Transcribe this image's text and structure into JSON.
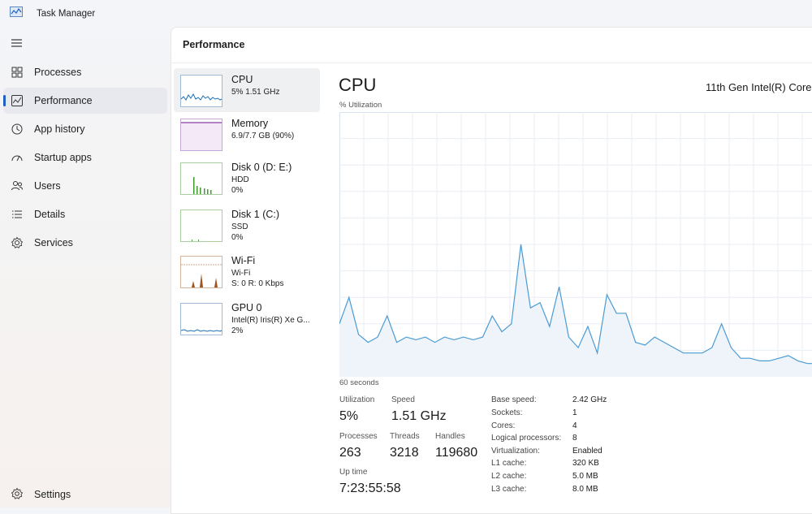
{
  "window": {
    "title": "Task Manager"
  },
  "nav": {
    "items": [
      {
        "label": "Processes",
        "icon": "processes-icon"
      },
      {
        "label": "Performance",
        "icon": "performance-icon",
        "selected": true
      },
      {
        "label": "App history",
        "icon": "app-history-icon"
      },
      {
        "label": "Startup apps",
        "icon": "startup-apps-icon"
      },
      {
        "label": "Users",
        "icon": "users-icon"
      },
      {
        "label": "Details",
        "icon": "details-icon"
      },
      {
        "label": "Services",
        "icon": "services-icon"
      }
    ],
    "settings_label": "Settings"
  },
  "main": {
    "header": "Performance"
  },
  "devices": [
    {
      "name": "CPU",
      "line1": "5%  1.51 GHz",
      "line2": "",
      "color": "#1b6fb8",
      "selected": true
    },
    {
      "name": "Memory",
      "line1": "6.9/7.7 GB (90%)",
      "line2": "",
      "color": "#8b3fa8"
    },
    {
      "name": "Disk 0 (D: E:)",
      "line1": "HDD",
      "line2": "0%",
      "color": "#3f9b2e"
    },
    {
      "name": "Disk 1 (C:)",
      "line1": "SSD",
      "line2": "0%",
      "color": "#3f9b2e"
    },
    {
      "name": "Wi-Fi",
      "line1": "Wi-Fi",
      "line2": "S: 0 R: 0 Kbps",
      "color": "#a0521d"
    },
    {
      "name": "GPU 0",
      "line1": "Intel(R) Iris(R) Xe G...",
      "line2": "2%",
      "color": "#1b6fb8"
    }
  ],
  "detail": {
    "title": "CPU",
    "model": "11th Gen Intel(R) Core",
    "util_label": "% Utilization",
    "time_label": "60 seconds",
    "stats": {
      "utilization_label": "Utilization",
      "utilization": "5%",
      "speed_label": "Speed",
      "speed": "1.51 GHz",
      "processes_label": "Processes",
      "processes": "263",
      "threads_label": "Threads",
      "threads": "3218",
      "handles_label": "Handles",
      "handles": "119680",
      "uptime_label": "Up time",
      "uptime": "7:23:55:58"
    },
    "specs": [
      {
        "key": "Base speed:",
        "value": "2.42 GHz"
      },
      {
        "key": "Sockets:",
        "value": "1"
      },
      {
        "key": "Cores:",
        "value": "4"
      },
      {
        "key": "Logical processors:",
        "value": "8"
      },
      {
        "key": "Virtualization:",
        "value": "Enabled"
      },
      {
        "key": "L1 cache:",
        "value": "320 KB"
      },
      {
        "key": "L2 cache:",
        "value": "5.0 MB"
      },
      {
        "key": "L3 cache:",
        "value": "8.0 MB"
      }
    ],
    "cpu_history": [
      20,
      30,
      16,
      13,
      15,
      23,
      13,
      15,
      14,
      15,
      13,
      15,
      14,
      15,
      14,
      15,
      23,
      17,
      20,
      50,
      26,
      28,
      19,
      34,
      15,
      11,
      19,
      9,
      31,
      24,
      24,
      13,
      12,
      15,
      13,
      11,
      9,
      9,
      9,
      11,
      20,
      11,
      7,
      7,
      6,
      6,
      7,
      8,
      6,
      5,
      5,
      5
    ]
  },
  "colors": {
    "accent": "#1f5fbf",
    "cpu_line": "#4a9bd4",
    "cpu_fill": "#eef4fa",
    "grid": "#e9eef3"
  }
}
